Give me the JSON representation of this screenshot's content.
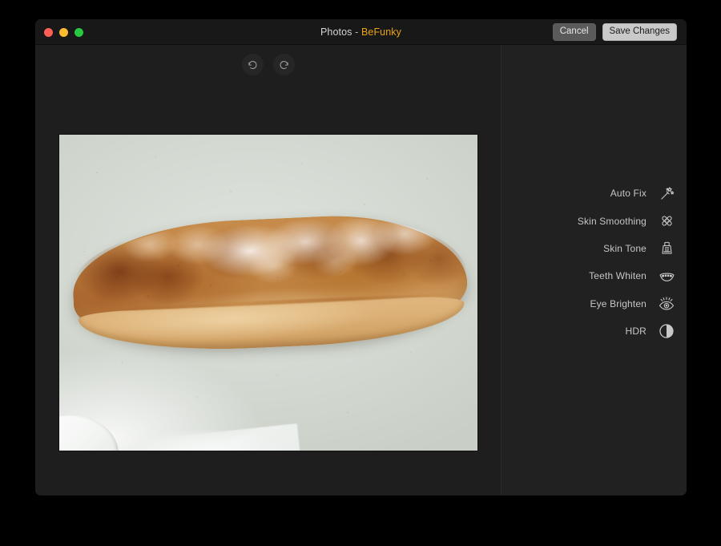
{
  "window": {
    "title_app": "Photos",
    "title_separator": "-",
    "title_brand": "BeFunky",
    "brand_color": "#e8a317"
  },
  "traffic_lights": [
    {
      "name": "close",
      "color": "#ff5f57"
    },
    {
      "name": "minimize",
      "color": "#febc2e"
    },
    {
      "name": "maximize",
      "color": "#28c840"
    }
  ],
  "titlebar": {
    "cancel_label": "Cancel",
    "save_label": "Save Changes"
  },
  "history": {
    "undo_icon": "undo-arrow-icon",
    "redo_icon": "redo-arrow-icon"
  },
  "canvas": {
    "photo_alt": "Rustic flour-dusted bread loaf on a pale grey-green countertop",
    "photo_subject": "bread loaf",
    "photo_background": "#d5dad3",
    "loaf_crust_color": "#c38645"
  },
  "sidebar": {
    "tools": [
      {
        "label": "Auto Fix",
        "icon": "magic-wand-icon"
      },
      {
        "label": "Skin Smoothing",
        "icon": "bandage-cross-icon"
      },
      {
        "label": "Skin Tone",
        "icon": "lotion-tube-icon"
      },
      {
        "label": "Teeth Whiten",
        "icon": "smile-teeth-icon"
      },
      {
        "label": "Eye Brighten",
        "icon": "eye-rays-icon"
      },
      {
        "label": "HDR",
        "icon": "contrast-circle-icon"
      }
    ]
  }
}
